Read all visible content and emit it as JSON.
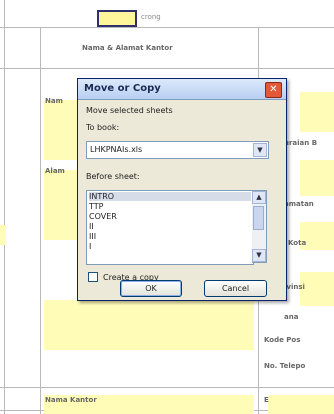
{
  "background": {
    "top_small_text": "crong",
    "header_title": "Nama & Alamat Kantor",
    "row1_left": "Nam",
    "row2_left": "Alam",
    "right_labels": [
      "uraian B",
      "amatan",
      "Kota",
      "ivinsi",
      "ana",
      "Kode Pos",
      "No. Telepo"
    ],
    "bottom_left": "Nama Kantor",
    "bottom_right": "E"
  },
  "dialog": {
    "title": "Move or Copy",
    "close_symbol": "✕",
    "subtitle": "Move selected sheets",
    "to_book_label": "To book:",
    "to_book_value": "LHKPNAIs.xls",
    "before_sheet_label": "Before sheet:",
    "sheets": [
      "INTRO",
      "TTP",
      "COVER",
      "II",
      "III",
      "I"
    ],
    "selected_sheet": "INTRO",
    "create_copy_label": "Create a copy",
    "create_copy_checked": false,
    "ok_label": "OK",
    "cancel_label": "Cancel"
  },
  "colors": {
    "cell_fill": "#fffcb8",
    "dialog_face": "#ece9d8",
    "title_gradient": "#b8cff2",
    "close_red": "#e4583a"
  }
}
